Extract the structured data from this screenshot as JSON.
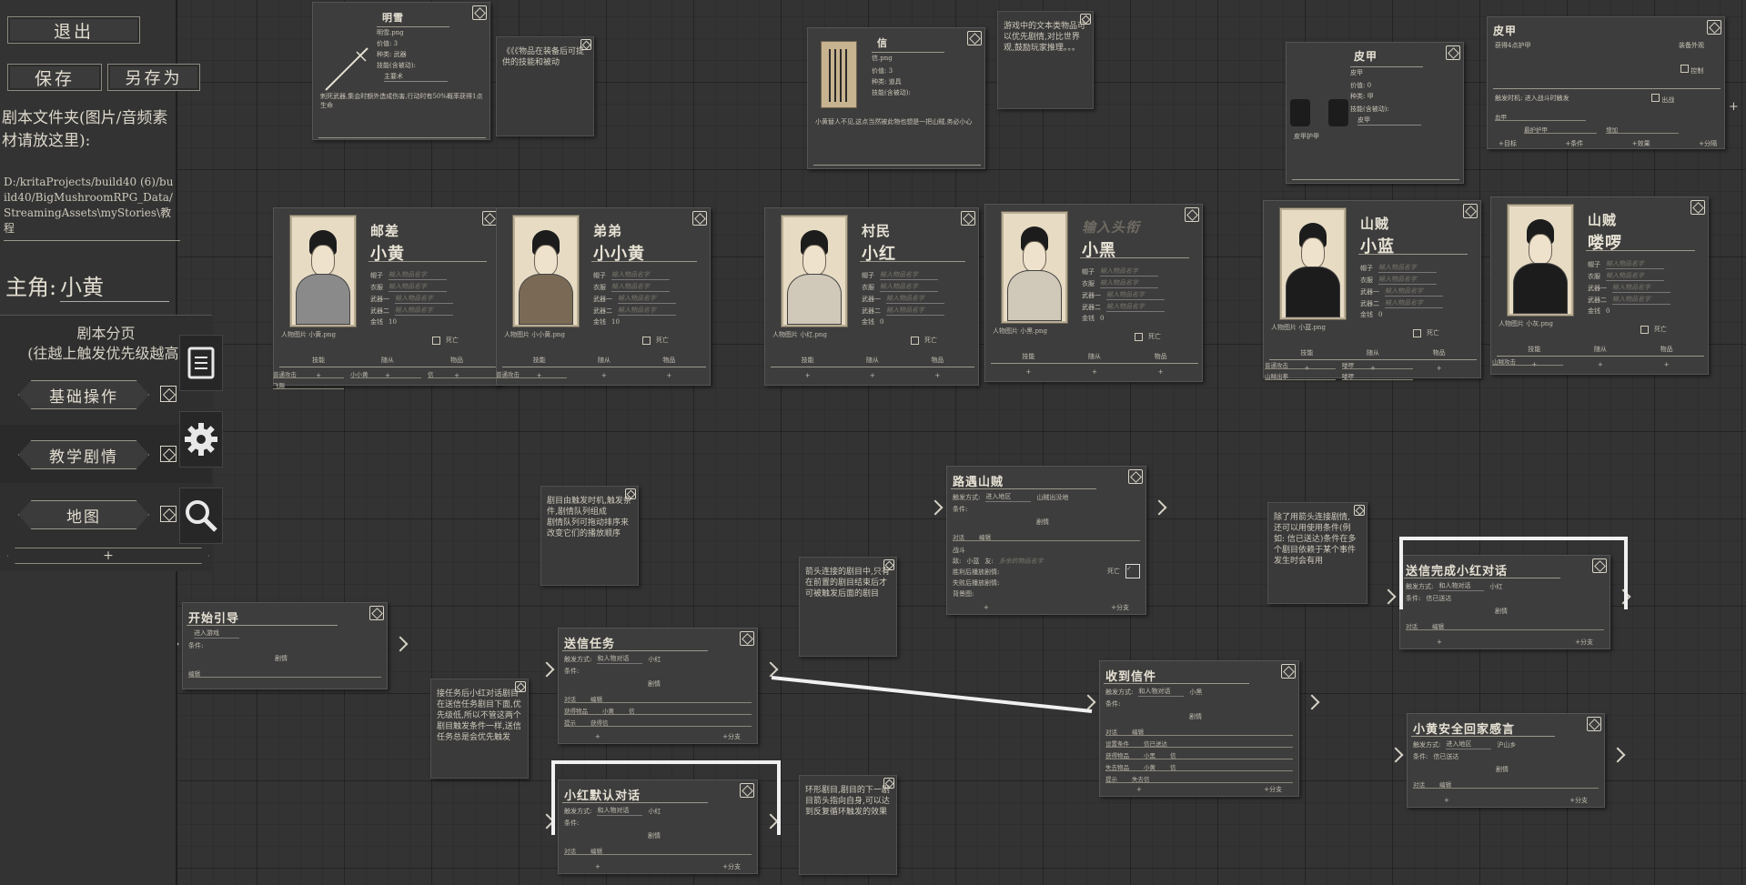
{
  "sidebar": {
    "exit": "退出",
    "save": "保存",
    "save_as": "另存为",
    "folder_hint": "剧本文件夹(图片/音频素材请放这里):",
    "folder_path": "D:/kritaProjects/build40 (6)/build40/BigMushroomRPG_Data/StreamingAssets\\myStories\\教程",
    "protagonist_label": "主角:",
    "protagonist_value": "小黄",
    "pages_title": "剧本分页",
    "pages_hint": "(往越上触发优先级越高)",
    "pages": [
      "基础操作",
      "教学剧情",
      "地图"
    ],
    "add": "+"
  },
  "tools": [
    "book-icon",
    "gear-icon",
    "search-icon"
  ],
  "items": [
    {
      "id": "item1",
      "title": "明雪",
      "img": "明雪.png",
      "price": "价值: 3",
      "kind": "种类:",
      "kind_val": "武器",
      "skill": "技能(含被动):",
      "skill_val": "主要术",
      "desc": "刺死武器,集会时额外造成伤害,行动时有50%概率获得1点生命"
    },
    {
      "id": "item2",
      "title": "信",
      "img": "信.png",
      "price": "价值: 3",
      "kind": "种类:",
      "kind_val": "道具",
      "skill": "技能(含被动):",
      "desc": "小黄替人不见,这点当然被此物也想是一把山贼,务必小心"
    },
    {
      "id": "item3",
      "title": "皮甲",
      "img": "皮甲",
      "price": "价值: 0",
      "kind": "种类:",
      "kind_val": "甲",
      "skill": "技能(含被动):",
      "skill_val": "皮甲",
      "desc": "皮甲护甲"
    },
    {
      "id": "item4",
      "title": "皮甲",
      "desc": "获得4点护甲",
      "extra": "装备外观",
      "control": "控制",
      "trigger": "触发时机:",
      "trigger_val": "进入战斗时触发",
      "flag": "出战",
      "rows": [
        "血甲",
        "最护护甲",
        "增加"
      ],
      "foot": [
        "+目标",
        "+条件",
        "+效果",
        "+分隔"
      ]
    }
  ],
  "notes": [
    "《《《物品在装备后可提供的技能和被动",
    "游戏中的文本类物品可以优先剧情,对比世界观,鼓励玩家推理。。。",
    "剧目由触发时机,触发条件,剧情队列组成\n剧情队列可拖动排序来改变它们的播放顺序",
    "箭头连接的剧目中,只有在前置的剧目结束后才可被触发后面的剧目",
    "除了用箭头连接剧情,\n还可以用使用条件(例如: 信已送达)条件在多个剧目依赖于某个事件发生时会有用",
    "接任务后小红对话剧目在送信任务剧目下面,优先级低,所以不管这两个剧目触发条件一样,送信任务总是会优先触发",
    "环形剧目,剧目的下一剧目箭头指向自身,可以达到反复循环触发的效果"
  ],
  "characters": [
    {
      "id": "c1",
      "role": "邮差",
      "name": "小黄",
      "img": "人物图片 小黄.png",
      "money": "10"
    },
    {
      "id": "c2",
      "role": "弟弟",
      "name": "小小黄",
      "img": "人物图片 小小黄.png",
      "money": "10"
    },
    {
      "id": "c3",
      "role": "村民",
      "name": "小红",
      "img": "人物图片 小红.png",
      "money": "0"
    },
    {
      "id": "c4",
      "role": "输入头衔",
      "name": "小黑",
      "img": "人物图片 小黑.png",
      "money": "0"
    },
    {
      "id": "c5",
      "role": "山贼",
      "name": "小蓝",
      "img": "人物图片 小蓝.png",
      "money": "0"
    },
    {
      "id": "c6",
      "role": "山贼",
      "name": "喽啰",
      "img": "人物图片 小灰.png",
      "money": "0"
    }
  ],
  "char_fields": {
    "hat": "帽子",
    "clothes": "衣服",
    "weapon1": "武器一",
    "weapon2": "武器二",
    "money": "金钱",
    "placeholder": "输入物品名字",
    "dead": "死亡",
    "skills": "技能",
    "followers": "随从",
    "goods": "物品"
  },
  "char_extra": {
    "c1_skill": "普通攻击",
    "c1_skill2": "飞踢",
    "c1_follow": "小小黄",
    "c1_goods": "信",
    "c2_skill": "普通攻击",
    "c5_a": "普通攻击",
    "c5_b": "山贼出拳",
    "c5_c": "喽啰",
    "c5_d": "喽啰",
    "c6_a": "山贼攻击"
  },
  "plots": [
    {
      "id": "p0",
      "title": "开始引导",
      "trig": "进入游戏",
      "cond": "条件:",
      "plot": "剧情",
      "edit": "编辑"
    },
    {
      "id": "p1",
      "title": "送信任务",
      "trig_lbl": "触发方式:",
      "trig": "和人物对话",
      "who": "小红",
      "cond": "条件:",
      "plot": "剧情",
      "rows": [
        [
          "对话",
          "编辑"
        ],
        [
          "获得物品",
          "小黄",
          "信"
        ],
        [
          "提示",
          "获得信"
        ]
      ],
      "add": "+",
      "add_branch": "+分支"
    },
    {
      "id": "p2",
      "title": "路遇山贼",
      "trig_lbl": "触发方式:",
      "trig": "进入地区",
      "where": "山贼出没地",
      "cond": "条件:",
      "plot": "剧情",
      "rows": [
        [
          "对话",
          "编辑"
        ]
      ],
      "battle": "战斗",
      "enemy": "敌:",
      "enemy_val": "小蓝",
      "ally": "友:",
      "ally_val": "多余的物品名字",
      "win": "胜利后播放剧情:",
      "lose": "失败后播放剧情:",
      "bg": "背景图:",
      "dead": "死亡",
      "add": "+",
      "add_branch": "+分支"
    },
    {
      "id": "p3",
      "title": "收到信件",
      "trig_lbl": "触发方式:",
      "trig": "和人物对话",
      "who": "小黑",
      "cond": "条件:",
      "plot": "剧情",
      "rows": [
        [
          "对话",
          "编辑"
        ],
        [
          "设置条件",
          "信已送达"
        ],
        [
          "获得物品",
          "小黑",
          "信"
        ],
        [
          "失去物品",
          "小黄",
          "信"
        ],
        [
          "提示",
          "失去信"
        ]
      ],
      "add": "+",
      "add_branch": "+分支"
    },
    {
      "id": "p4",
      "title": "送信完成小红对话",
      "trig_lbl": "触发方式:",
      "trig": "和人物对话",
      "who": "小红",
      "cond": "条件:",
      "cond_val": "信已送达",
      "plot": "剧情",
      "rows": [
        [
          "对话",
          "编辑"
        ]
      ],
      "add": "+",
      "add_branch": "+分支"
    },
    {
      "id": "p5",
      "title": "小黄安全回家感言",
      "trig_lbl": "触发方式:",
      "trig": "进入地区",
      "where": "沪山乡",
      "cond": "条件:",
      "cond_val": "信已送达",
      "plot": "剧情",
      "rows": [
        [
          "对话",
          "编辑"
        ]
      ],
      "add": "+",
      "add_branch": "+分支"
    },
    {
      "id": "p6",
      "title": "小红默认对话",
      "trig_lbl": "触发方式:",
      "trig": "和人物对话",
      "who": "小红",
      "cond": "条件:",
      "plot": "剧情",
      "rows": [
        [
          "对话",
          "编辑"
        ]
      ],
      "add": "+",
      "add_branch": "+分支"
    }
  ]
}
